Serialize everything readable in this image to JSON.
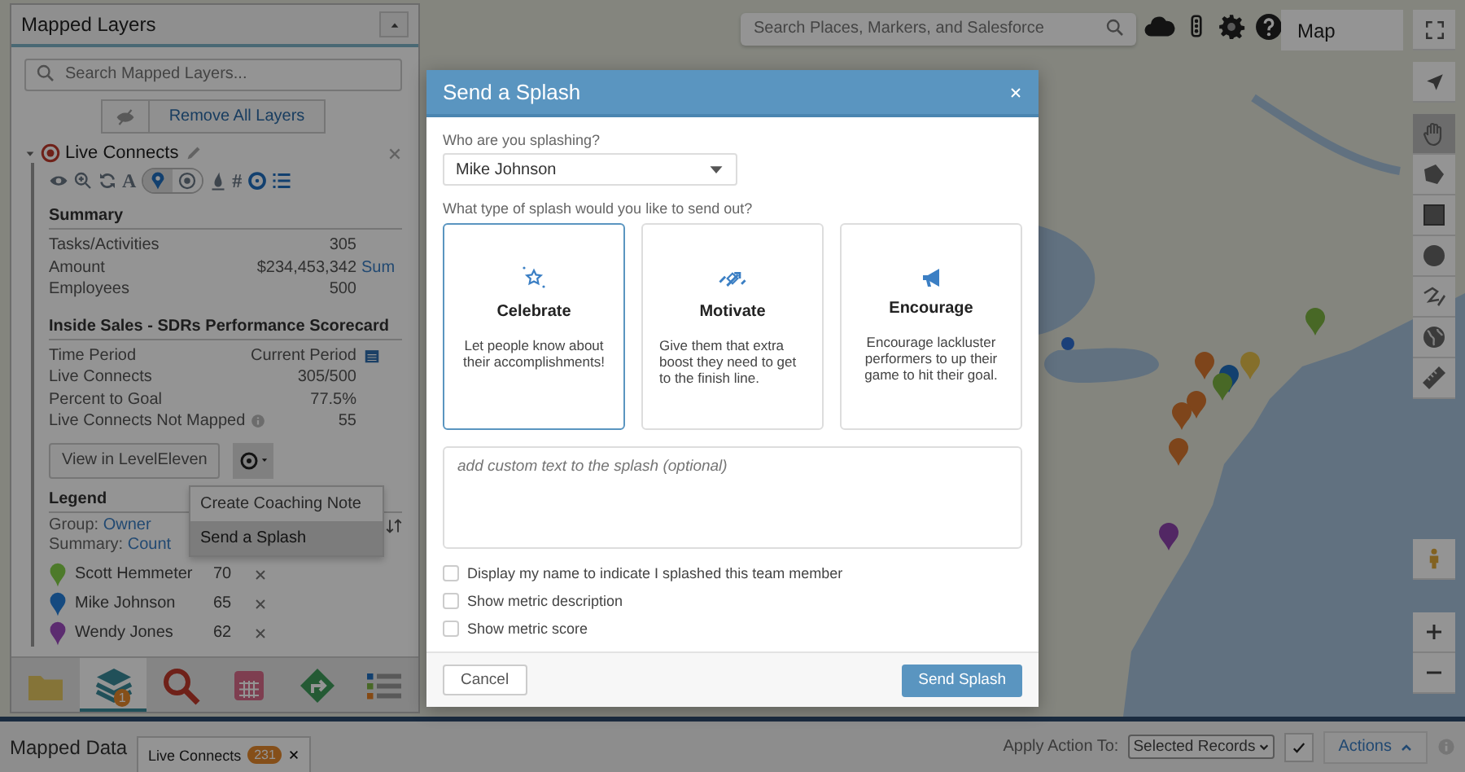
{
  "top_bar": {
    "search": {
      "placeholder": "Search Places, Markers, and Salesforce"
    },
    "map_type_button": "Map"
  },
  "layers_panel": {
    "title": "Mapped Layers",
    "search": {
      "placeholder": "Search Mapped Layers..."
    },
    "remove_all_button": "Remove All Layers",
    "layer": {
      "name": "Live Connects",
      "expanded": true,
      "tools": [
        {
          "kind": "eye"
        },
        {
          "kind": "zoom"
        },
        {
          "kind": "refresh"
        },
        {
          "kind": "glyph",
          "text": "A"
        }
      ],
      "marker_modes": [
        {
          "kind": "pin",
          "selected": true
        },
        {
          "kind": "target",
          "selected": false
        }
      ],
      "tools_after": [
        {
          "kind": "drop"
        },
        {
          "kind": "glyph",
          "text": "#"
        },
        {
          "kind": "ring"
        },
        {
          "kind": "list"
        }
      ],
      "summary": {
        "title": "Summary",
        "rows": [
          {
            "label": "Tasks/Activities",
            "value": "305"
          },
          {
            "label": "Amount",
            "value": "$234,453,342",
            "link": "Sum"
          },
          {
            "label": "Employees",
            "value": "500"
          }
        ]
      },
      "scorecard": {
        "title": "Inside Sales - SDRs Performance Scorecard",
        "rows": [
          {
            "label": "Time Period",
            "value": "Current Period",
            "kind": "date"
          },
          {
            "label": "Live Connects",
            "value": "305/500",
            "kind": "plain"
          },
          {
            "label": "Percent to Goal",
            "value": "77.5%",
            "kind": "plain"
          },
          {
            "label": "Live Connects Not Mapped",
            "value": "55",
            "kind": "info"
          }
        ]
      },
      "view_button": "View in LevelEleven",
      "menu": {
        "open": true,
        "items": [
          {
            "label": "Create Coaching Note",
            "selected": false
          },
          {
            "label": "Send a Splash",
            "selected": true
          }
        ]
      },
      "legend": {
        "title": "Legend",
        "group_label": "Group:",
        "group_value": "Owner",
        "summary_label": "Summary:",
        "summary_value": "Count",
        "items": [
          {
            "name": "Scott Hemmeter",
            "count": "70",
            "color": "#4d7a2a"
          },
          {
            "name": "Mike Johnson",
            "count": "65",
            "color": "#154a80"
          },
          {
            "name": "Wendy Jones",
            "count": "62",
            "color": "#5c2c70"
          }
        ]
      }
    },
    "nav": [
      {
        "kind": "folder",
        "selected": false
      },
      {
        "kind": "layers",
        "selected": true,
        "badge": "1"
      },
      {
        "kind": "search",
        "selected": false
      },
      {
        "kind": "calendar",
        "selected": false
      },
      {
        "kind": "route",
        "selected": false
      },
      {
        "kind": "legend",
        "selected": false
      }
    ]
  },
  "map_tools": [
    {
      "kind": "hand",
      "selected": true
    },
    {
      "kind": "polygon",
      "selected": false
    },
    {
      "kind": "rectangle",
      "selected": false
    },
    {
      "kind": "circle",
      "selected": false
    },
    {
      "kind": "draw",
      "selected": false
    },
    {
      "kind": "globe",
      "selected": false
    },
    {
      "kind": "ruler",
      "selected": false
    }
  ],
  "modal": {
    "title": "Send a Splash",
    "recipient": {
      "label": "Who are you splashing?",
      "value": "Mike Johnson"
    },
    "type_prompt": "What type of splash would you like to send out?",
    "types": [
      {
        "kind": "celebrate",
        "title": "Celebrate",
        "description": "Let people know about their accomplishments!",
        "selected": true
      },
      {
        "kind": "motivate",
        "title": "Motivate",
        "description": "Give them that extra boost they need to get to the finish line.",
        "selected": false
      },
      {
        "kind": "encourage",
        "title": "Encourage",
        "description": "Encourage lackluster performers to up their game to hit their goal.",
        "selected": false
      }
    ],
    "message": {
      "placeholder": "add custom text to the splash (optional)"
    },
    "options": [
      {
        "label": "Display my name to indicate I splashed this team member",
        "checked": false
      },
      {
        "label": "Show metric description",
        "checked": false
      },
      {
        "label": "Show metric score",
        "checked": false
      }
    ],
    "cancel_button": "Cancel",
    "send_button": "Send Splash"
  },
  "bottom_bar": {
    "title": "Mapped Data",
    "tabs": [
      {
        "label": "Live Connects",
        "count": "231",
        "selected": true
      }
    ],
    "apply_label": "Apply Action To:",
    "apply_select": "Selected Records",
    "actions_button": "Actions"
  }
}
